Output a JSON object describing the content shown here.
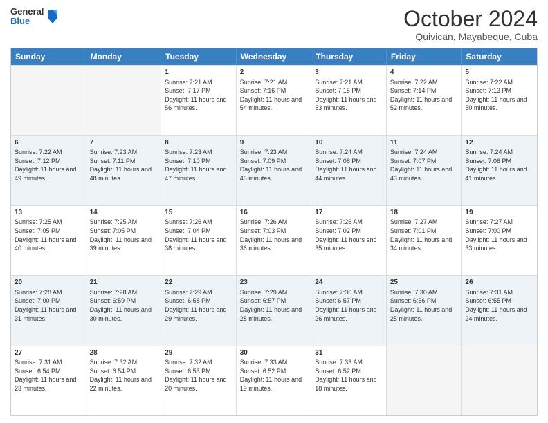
{
  "header": {
    "logo": {
      "general": "General",
      "blue": "Blue"
    },
    "title": "October 2024",
    "location": "Quivican, Mayabeque, Cuba"
  },
  "calendar": {
    "days_of_week": [
      "Sunday",
      "Monday",
      "Tuesday",
      "Wednesday",
      "Thursday",
      "Friday",
      "Saturday"
    ],
    "weeks": [
      [
        {
          "day": "",
          "sunrise": "",
          "sunset": "",
          "daylight": ""
        },
        {
          "day": "",
          "sunrise": "",
          "sunset": "",
          "daylight": ""
        },
        {
          "day": "1",
          "sunrise": "Sunrise: 7:21 AM",
          "sunset": "Sunset: 7:17 PM",
          "daylight": "Daylight: 11 hours and 56 minutes."
        },
        {
          "day": "2",
          "sunrise": "Sunrise: 7:21 AM",
          "sunset": "Sunset: 7:16 PM",
          "daylight": "Daylight: 11 hours and 54 minutes."
        },
        {
          "day": "3",
          "sunrise": "Sunrise: 7:21 AM",
          "sunset": "Sunset: 7:15 PM",
          "daylight": "Daylight: 11 hours and 53 minutes."
        },
        {
          "day": "4",
          "sunrise": "Sunrise: 7:22 AM",
          "sunset": "Sunset: 7:14 PM",
          "daylight": "Daylight: 11 hours and 52 minutes."
        },
        {
          "day": "5",
          "sunrise": "Sunrise: 7:22 AM",
          "sunset": "Sunset: 7:13 PM",
          "daylight": "Daylight: 11 hours and 50 minutes."
        }
      ],
      [
        {
          "day": "6",
          "sunrise": "Sunrise: 7:22 AM",
          "sunset": "Sunset: 7:12 PM",
          "daylight": "Daylight: 11 hours and 49 minutes."
        },
        {
          "day": "7",
          "sunrise": "Sunrise: 7:23 AM",
          "sunset": "Sunset: 7:11 PM",
          "daylight": "Daylight: 11 hours and 48 minutes."
        },
        {
          "day": "8",
          "sunrise": "Sunrise: 7:23 AM",
          "sunset": "Sunset: 7:10 PM",
          "daylight": "Daylight: 11 hours and 47 minutes."
        },
        {
          "day": "9",
          "sunrise": "Sunrise: 7:23 AM",
          "sunset": "Sunset: 7:09 PM",
          "daylight": "Daylight: 11 hours and 45 minutes."
        },
        {
          "day": "10",
          "sunrise": "Sunrise: 7:24 AM",
          "sunset": "Sunset: 7:08 PM",
          "daylight": "Daylight: 11 hours and 44 minutes."
        },
        {
          "day": "11",
          "sunrise": "Sunrise: 7:24 AM",
          "sunset": "Sunset: 7:07 PM",
          "daylight": "Daylight: 11 hours and 43 minutes."
        },
        {
          "day": "12",
          "sunrise": "Sunrise: 7:24 AM",
          "sunset": "Sunset: 7:06 PM",
          "daylight": "Daylight: 11 hours and 41 minutes."
        }
      ],
      [
        {
          "day": "13",
          "sunrise": "Sunrise: 7:25 AM",
          "sunset": "Sunset: 7:05 PM",
          "daylight": "Daylight: 11 hours and 40 minutes."
        },
        {
          "day": "14",
          "sunrise": "Sunrise: 7:25 AM",
          "sunset": "Sunset: 7:05 PM",
          "daylight": "Daylight: 11 hours and 39 minutes."
        },
        {
          "day": "15",
          "sunrise": "Sunrise: 7:26 AM",
          "sunset": "Sunset: 7:04 PM",
          "daylight": "Daylight: 11 hours and 38 minutes."
        },
        {
          "day": "16",
          "sunrise": "Sunrise: 7:26 AM",
          "sunset": "Sunset: 7:03 PM",
          "daylight": "Daylight: 11 hours and 36 minutes."
        },
        {
          "day": "17",
          "sunrise": "Sunrise: 7:26 AM",
          "sunset": "Sunset: 7:02 PM",
          "daylight": "Daylight: 11 hours and 35 minutes."
        },
        {
          "day": "18",
          "sunrise": "Sunrise: 7:27 AM",
          "sunset": "Sunset: 7:01 PM",
          "daylight": "Daylight: 11 hours and 34 minutes."
        },
        {
          "day": "19",
          "sunrise": "Sunrise: 7:27 AM",
          "sunset": "Sunset: 7:00 PM",
          "daylight": "Daylight: 11 hours and 33 minutes."
        }
      ],
      [
        {
          "day": "20",
          "sunrise": "Sunrise: 7:28 AM",
          "sunset": "Sunset: 7:00 PM",
          "daylight": "Daylight: 11 hours and 31 minutes."
        },
        {
          "day": "21",
          "sunrise": "Sunrise: 7:28 AM",
          "sunset": "Sunset: 6:59 PM",
          "daylight": "Daylight: 11 hours and 30 minutes."
        },
        {
          "day": "22",
          "sunrise": "Sunrise: 7:29 AM",
          "sunset": "Sunset: 6:58 PM",
          "daylight": "Daylight: 11 hours and 29 minutes."
        },
        {
          "day": "23",
          "sunrise": "Sunrise: 7:29 AM",
          "sunset": "Sunset: 6:57 PM",
          "daylight": "Daylight: 11 hours and 28 minutes."
        },
        {
          "day": "24",
          "sunrise": "Sunrise: 7:30 AM",
          "sunset": "Sunset: 6:57 PM",
          "daylight": "Daylight: 11 hours and 26 minutes."
        },
        {
          "day": "25",
          "sunrise": "Sunrise: 7:30 AM",
          "sunset": "Sunset: 6:56 PM",
          "daylight": "Daylight: 11 hours and 25 minutes."
        },
        {
          "day": "26",
          "sunrise": "Sunrise: 7:31 AM",
          "sunset": "Sunset: 6:55 PM",
          "daylight": "Daylight: 11 hours and 24 minutes."
        }
      ],
      [
        {
          "day": "27",
          "sunrise": "Sunrise: 7:31 AM",
          "sunset": "Sunset: 6:54 PM",
          "daylight": "Daylight: 11 hours and 23 minutes."
        },
        {
          "day": "28",
          "sunrise": "Sunrise: 7:32 AM",
          "sunset": "Sunset: 6:54 PM",
          "daylight": "Daylight: 11 hours and 22 minutes."
        },
        {
          "day": "29",
          "sunrise": "Sunrise: 7:32 AM",
          "sunset": "Sunset: 6:53 PM",
          "daylight": "Daylight: 11 hours and 20 minutes."
        },
        {
          "day": "30",
          "sunrise": "Sunrise: 7:33 AM",
          "sunset": "Sunset: 6:52 PM",
          "daylight": "Daylight: 11 hours and 19 minutes."
        },
        {
          "day": "31",
          "sunrise": "Sunrise: 7:33 AM",
          "sunset": "Sunset: 6:52 PM",
          "daylight": "Daylight: 11 hours and 18 minutes."
        },
        {
          "day": "",
          "sunrise": "",
          "sunset": "",
          "daylight": ""
        },
        {
          "day": "",
          "sunrise": "",
          "sunset": "",
          "daylight": ""
        }
      ]
    ]
  }
}
